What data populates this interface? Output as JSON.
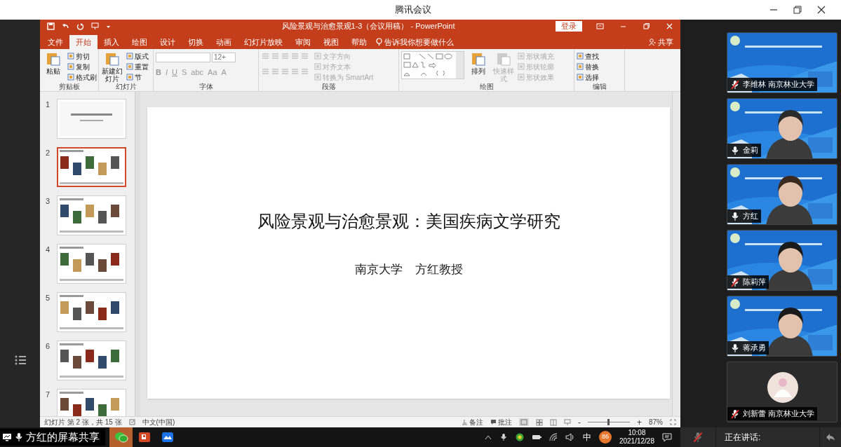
{
  "app_title": "腾讯会议",
  "ppt": {
    "title": "风险景观与治愈景观1-3（会议用稿） - PowerPoint",
    "login": "登录",
    "share": "共享",
    "tell_me": "告诉我你想要做什么",
    "tabs": [
      {
        "label": "文件",
        "selected": false
      },
      {
        "label": "开始",
        "selected": true
      },
      {
        "label": "插入",
        "selected": false
      },
      {
        "label": "绘图",
        "selected": false
      },
      {
        "label": "设计",
        "selected": false
      },
      {
        "label": "切换",
        "selected": false
      },
      {
        "label": "动画",
        "selected": false
      },
      {
        "label": "幻灯片放映",
        "selected": false
      },
      {
        "label": "审阅",
        "selected": false
      },
      {
        "label": "视图",
        "selected": false
      },
      {
        "label": "帮助",
        "selected": false
      }
    ],
    "ribbon_groups": [
      {
        "label": "剪贴板",
        "items": [
          {
            "kind": "large",
            "label": "粘贴",
            "disabled": false
          },
          {
            "kind": "small",
            "label": "剪切",
            "disabled": false
          },
          {
            "kind": "small",
            "label": "复制",
            "disabled": false
          },
          {
            "kind": "small",
            "label": "格式刷",
            "disabled": false
          }
        ]
      },
      {
        "label": "幻灯片",
        "items": [
          {
            "kind": "large",
            "label": "新建幻灯片",
            "disabled": false
          },
          {
            "kind": "small",
            "label": "版式",
            "disabled": false
          },
          {
            "kind": "small",
            "label": "重置",
            "disabled": false
          },
          {
            "kind": "small",
            "label": "节",
            "disabled": false
          }
        ]
      },
      {
        "label": "字体",
        "items": [
          {
            "kind": "font_controls",
            "size": "12+",
            "buttons": [
              "B",
              "I",
              "U",
              "S",
              "abc",
              "Aa",
              "A"
            ]
          }
        ]
      },
      {
        "label": "段落",
        "items": [
          {
            "kind": "para_icons"
          },
          {
            "kind": "small",
            "label": "文字方向",
            "disabled": true
          },
          {
            "kind": "small",
            "label": "对齐文本",
            "disabled": true
          },
          {
            "kind": "small",
            "label": "转换为 SmartArt",
            "disabled": true
          }
        ]
      },
      {
        "label": "绘图",
        "items": [
          {
            "kind": "gallery"
          },
          {
            "kind": "large",
            "label": "排列",
            "disabled": false
          },
          {
            "kind": "large",
            "label": "快速样式",
            "disabled": true
          },
          {
            "kind": "small",
            "label": "形状填充",
            "disabled": true
          },
          {
            "kind": "small",
            "label": "形状轮廓",
            "disabled": true
          },
          {
            "kind": "small",
            "label": "形状效果",
            "disabled": true
          }
        ]
      },
      {
        "label": "编辑",
        "items": [
          {
            "kind": "small",
            "label": "查找",
            "disabled": false
          },
          {
            "kind": "small",
            "label": "替换",
            "disabled": false
          },
          {
            "kind": "small",
            "label": "选择",
            "disabled": false
          }
        ]
      }
    ],
    "thumbnails": [
      {
        "number": "1",
        "selected": false
      },
      {
        "number": "2",
        "selected": true
      },
      {
        "number": "3",
        "selected": false
      },
      {
        "number": "4",
        "selected": false
      },
      {
        "number": "5",
        "selected": false
      },
      {
        "number": "6",
        "selected": false
      },
      {
        "number": "7",
        "selected": false
      }
    ],
    "slide": {
      "title": "风险景观与治愈景观：美国疾病文学研究",
      "organization": "南京大学",
      "author": "方红教授"
    },
    "status_bar": {
      "slide_info": "幻灯片 第 2 张，共 15 张",
      "language": "中文(中国)",
      "notes": "备注",
      "comments": "批注",
      "zoom": "87%",
      "zoom_out": "-",
      "zoom_in": "+",
      "zoom_slider": {
        "level": 0.5
      }
    }
  },
  "participants": [
    {
      "kind": "slide",
      "name": "李维林 南京林业大学",
      "muted": true
    },
    {
      "kind": "video",
      "name": "金莉",
      "muted": false
    },
    {
      "kind": "video",
      "name": "方红",
      "muted": false
    },
    {
      "kind": "video",
      "name": "陈莉萍",
      "muted": true
    },
    {
      "kind": "video",
      "name": "蒋承勇",
      "muted": false
    },
    {
      "kind": "avatar",
      "name": "刘新蕾 南京林业大学",
      "muted": true
    }
  ],
  "taskbar": {
    "share_label": "方红的屏幕共享",
    "apps": [
      {
        "kind": "chat",
        "selected": true
      },
      {
        "kind": "slides",
        "selected": false
      },
      {
        "kind": "meeting",
        "selected": false
      }
    ],
    "ime": "中",
    "badge": "86",
    "time": "10:08",
    "date": "2021/12/28"
  },
  "meeting_bar": {
    "speaking": "正在讲话:",
    "muted": true
  }
}
